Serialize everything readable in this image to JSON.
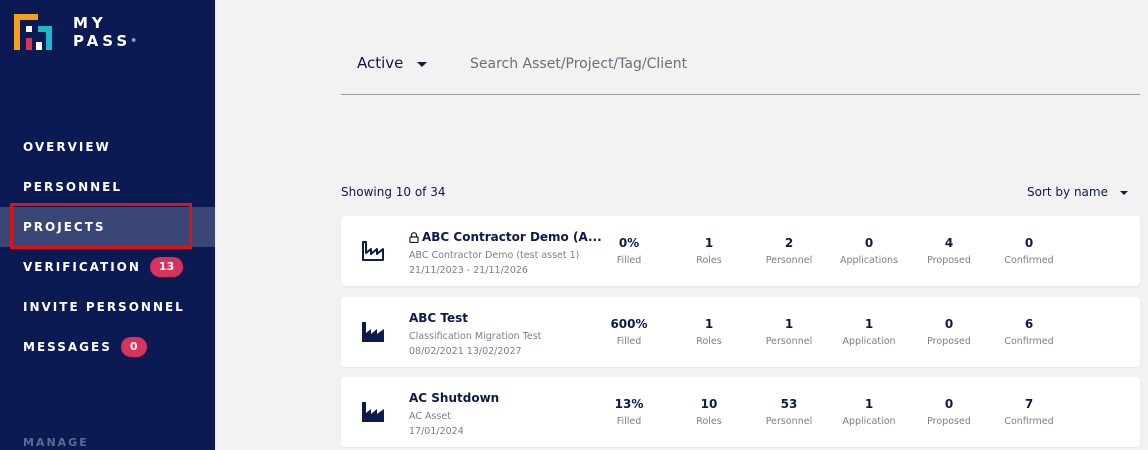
{
  "brand": {
    "line1": "MY",
    "line2": "PASS",
    "reg": "®"
  },
  "sidebar": {
    "items": [
      {
        "label": "OVERVIEW"
      },
      {
        "label": "PERSONNEL"
      },
      {
        "label": "PROJECTS",
        "active": true
      },
      {
        "label": "VERIFICATION",
        "badge": "13"
      },
      {
        "label": "INVITE PERSONNEL"
      },
      {
        "label": "MESSAGES",
        "badge": "0"
      }
    ],
    "section": "MANAGE"
  },
  "filter": {
    "status": "Active",
    "search_placeholder": "Search Asset/Project/Tag/Client"
  },
  "list": {
    "showing": "Showing 10 of 34",
    "sort": "Sort by name"
  },
  "colors": {
    "sidebar": "#0b1a52",
    "accent_badge": "#d6345d",
    "highlight": "#d8141a"
  },
  "projects": [
    {
      "title": "ABC Contractor Demo (A...",
      "locked": true,
      "icon": "factory-outline-icon",
      "subtitle": "ABC Contractor Demo (test asset 1)",
      "dates": "21/11/2023 - 21/11/2026",
      "stats": [
        {
          "value": "0%",
          "label": "Filled"
        },
        {
          "value": "1",
          "label": "Roles"
        },
        {
          "value": "2",
          "label": "Personnel"
        },
        {
          "value": "0",
          "label": "Applications"
        },
        {
          "value": "4",
          "label": "Proposed"
        },
        {
          "value": "0",
          "label": "Confirmed"
        }
      ]
    },
    {
      "title": "ABC Test",
      "locked": false,
      "icon": "factory-filled-icon",
      "subtitle": "Classification Migration Test",
      "dates": "08/02/2021 13/02/2027",
      "stats": [
        {
          "value": "600%",
          "label": "Filled"
        },
        {
          "value": "1",
          "label": "Roles"
        },
        {
          "value": "1",
          "label": "Personnel"
        },
        {
          "value": "1",
          "label": "Application"
        },
        {
          "value": "0",
          "label": "Proposed"
        },
        {
          "value": "6",
          "label": "Confirmed"
        }
      ]
    },
    {
      "title": "AC Shutdown",
      "locked": false,
      "icon": "factory-filled-icon",
      "subtitle": "AC Asset",
      "dates": "17/01/2024",
      "stats": [
        {
          "value": "13%",
          "label": "Filled"
        },
        {
          "value": "10",
          "label": "Roles"
        },
        {
          "value": "53",
          "label": "Personnel"
        },
        {
          "value": "1",
          "label": "Application"
        },
        {
          "value": "0",
          "label": "Proposed"
        },
        {
          "value": "7",
          "label": "Confirmed"
        }
      ]
    }
  ]
}
